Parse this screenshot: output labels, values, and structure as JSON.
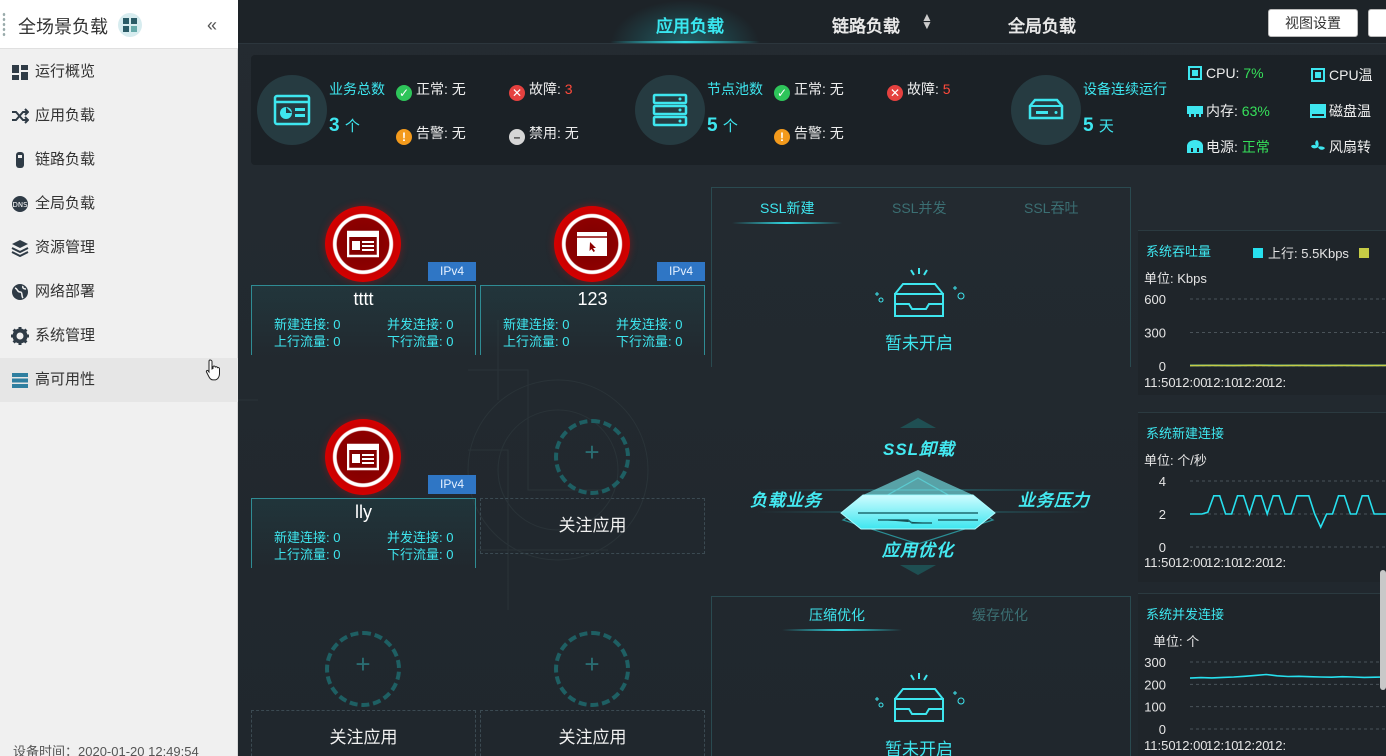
{
  "sidebar": {
    "title": "全场景负载",
    "items": [
      {
        "label": "运行概览",
        "icon": "dashboard-icon"
      },
      {
        "label": "应用负载",
        "icon": "shuffle-icon"
      },
      {
        "label": "链路负载",
        "icon": "link-icon"
      },
      {
        "label": "全局负载",
        "icon": "dns-icon"
      },
      {
        "label": "资源管理",
        "icon": "layers-icon"
      },
      {
        "label": "网络部署",
        "icon": "globe-icon"
      },
      {
        "label": "系统管理",
        "icon": "gear-icon"
      },
      {
        "label": "高可用性",
        "icon": "server-stack-icon"
      }
    ],
    "device_time": "设备时间：2020-01-20 12:49:54"
  },
  "topnav": {
    "tabs": [
      "应用负载",
      "链路负载",
      "全局负载"
    ],
    "active_tab": "应用负载",
    "view_settings": "视图设置"
  },
  "stats": {
    "business": {
      "title": "业务总数",
      "count": "3",
      "unit": "个",
      "normal_label": "正常:",
      "normal_value": "无",
      "fault_label": "故障:",
      "fault_value": "3",
      "warn_label": "告警:",
      "warn_value": "无",
      "disabled_label": "禁用:",
      "disabled_value": "无"
    },
    "pool": {
      "title": "节点池数",
      "count": "5",
      "unit": "个",
      "normal_label": "正常:",
      "normal_value": "无",
      "fault_label": "故障:",
      "fault_value": "5",
      "warn_label": "告警:",
      "warn_value": "无"
    },
    "device": {
      "title": "设备连续运行",
      "count": "5",
      "unit": "天"
    },
    "hardware": {
      "cpu_label": "CPU:",
      "cpu_value": "7%",
      "cpu_temp_label": "CPU温",
      "mem_label": "内存:",
      "mem_value": "63%",
      "disk_temp_label": "磁盘温",
      "power_label": "电源:",
      "power_value": "正常",
      "fan_label": "风扇转"
    }
  },
  "apps": [
    {
      "name": "tttt",
      "badge": "IPv4",
      "new_conn": "新建连接: 0",
      "concurrent": "并发连接: 0",
      "up": "上行流量: 0",
      "down": "下行流量: 0"
    },
    {
      "name": "123",
      "badge": "IPv4",
      "new_conn": "新建连接: 0",
      "concurrent": "并发连接: 0",
      "up": "上行流量: 0",
      "down": "下行流量: 0"
    },
    {
      "name": "lly",
      "badge": "IPv4",
      "new_conn": "新建连接: 0",
      "concurrent": "并发连接: 0",
      "up": "上行流量: 0",
      "down": "下行流量: 0"
    }
  ],
  "follow_label": "关注应用",
  "add_symbol": "+",
  "ssl": {
    "tabs": [
      "SSL新建",
      "SSL并发",
      "SSL吞吐"
    ],
    "not_open": "暂未开启",
    "center_top": "SSL卸载",
    "center_left": "负载业务",
    "center_right": "业务压力",
    "center_bottom": "应用优化",
    "bottom_tabs": [
      "压缩优化",
      "缓存优化"
    ],
    "bottom_not_open": "暂未开启"
  },
  "charts": {
    "throughput": {
      "title": "系统吞吐量",
      "unit": "单位: Kbps",
      "legend_up": "上行: 5.5Kbps",
      "up_color": "#27e0ee",
      "down_color": "#c6cc45"
    },
    "new_conn": {
      "title": "系统新建连接",
      "unit": "单位: 个/秒"
    },
    "concurrent": {
      "title": "系统并发连接",
      "unit": "单位: 个"
    }
  },
  "chart_data": [
    {
      "type": "line",
      "title": "系统吞吐量",
      "ylabel": "单位: Kbps",
      "x": [
        "11:50",
        "12:00",
        "12:10",
        "12:20",
        "12:"
      ],
      "yticks": [
        0,
        300,
        600
      ],
      "ylim": [
        0,
        600
      ],
      "series": [
        {
          "name": "上行: 5.5Kbps",
          "values": [
            5,
            6,
            5,
            7,
            5,
            6,
            5,
            6,
            5,
            6
          ]
        },
        {
          "name": "",
          "values": [
            4,
            5,
            4,
            6,
            4,
            5,
            4,
            5,
            4,
            5
          ]
        }
      ]
    },
    {
      "type": "line",
      "title": "系统新建连接",
      "ylabel": "单位: 个/秒",
      "x": [
        "11:50",
        "12:00",
        "12:10",
        "12:20",
        "12:"
      ],
      "yticks": [
        0,
        2,
        4
      ],
      "ylim": [
        0,
        4
      ],
      "series": [
        {
          "values": [
            2,
            2,
            2,
            2.1,
            3.1,
            3.1,
            2,
            2,
            3.1,
            3.1,
            2,
            3.1,
            3.1,
            2,
            3.1,
            3.1,
            2,
            2,
            3.1,
            3.1,
            3.1,
            2,
            1.2,
            2,
            2,
            3.1,
            3.1,
            2,
            2,
            3.1,
            3.1,
            2,
            2,
            2
          ]
        }
      ]
    },
    {
      "type": "line",
      "title": "系统并发连接",
      "ylabel": "单位: 个",
      "x": [
        "11:50",
        "12:00",
        "12:10",
        "12:20",
        "12:"
      ],
      "yticks": [
        0,
        100,
        200,
        300
      ],
      "ylim": [
        0,
        300
      ],
      "series": [
        {
          "values": [
            228,
            230,
            229,
            231,
            233,
            236,
            240,
            244,
            238,
            235,
            236,
            234,
            233,
            232,
            234,
            233,
            231,
            232,
            233
          ]
        }
      ]
    }
  ]
}
